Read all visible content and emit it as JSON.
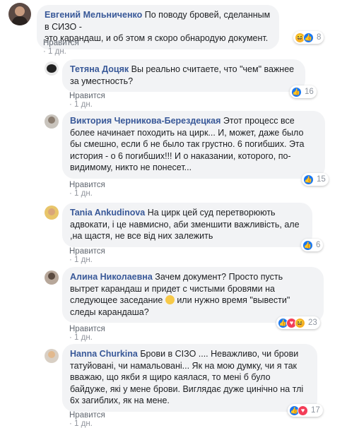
{
  "comments": [
    {
      "author": "Евгений Мельниченко",
      "lines": [
        "По поводу бровей, сделанным в СИЗО -",
        "это карандаш, и об этом я скоро обнародую документ."
      ],
      "like_label": "Нравится",
      "time": "1 дн.",
      "reactions": [
        "haha",
        "like"
      ],
      "count": "8"
    },
    {
      "author": "Тетяна Доцяк",
      "lines": [
        "Вы реально считаете, что \"чем\" важнее",
        "за уместность?"
      ],
      "like_label": "Нравится",
      "time": "1 дн.",
      "reactions": [
        "like"
      ],
      "count": "16"
    },
    {
      "author": "Виктория Черникова-Берездецкая",
      "lines": [
        "Этот процесс все",
        "более начинает походить на цирк... И, может, даже было",
        "бы смешно, если б не было так грустно. 6 погибших. Эта",
        "история - о 6 погибших!!! И о наказании, которого, по-",
        "видимому, никто не понесет..."
      ],
      "like_label": "Нравится",
      "time": "1 дн.",
      "reactions": [
        "like"
      ],
      "count": "15"
    },
    {
      "author": "Tania Ankudinova",
      "lines": [
        "На цирк цей суд перетворюють",
        "адвокати, і це навмисно, аби зменшити важливість, але",
        ",на щастя, не все від них залежить"
      ],
      "like_label": "Нравится",
      "time": "1 дн.",
      "reactions": [
        "like"
      ],
      "count": "6"
    },
    {
      "author": "Алина Николаевна",
      "lines": [
        "Зачем документ? Просто пусть",
        "вытрет карандаш и придет с чистыми бровями на",
        "следующее заседание",
        "или нужно время \"вывести\"",
        "следы карандаша?"
      ],
      "like_label": "Нравится",
      "time": "1 дн.",
      "reactions": [
        "like",
        "love",
        "haha"
      ],
      "count": "23"
    },
    {
      "author": "Hanna Churkina",
      "lines": [
        "Брови в СІЗО .... Неважливо, чи брови",
        "татуйовані, чи намальовані... Як на мою думку, чи я так",
        "вважаю, що якби я щиро каялася, то мені б було",
        "байдуже, які у мене брови. Виглядає дуже цинічно на тлі",
        "6х загиблих, як на мене."
      ],
      "like_label": "Нравится",
      "time": "1 дн.",
      "reactions": [
        "like",
        "love"
      ],
      "count": "17"
    }
  ]
}
